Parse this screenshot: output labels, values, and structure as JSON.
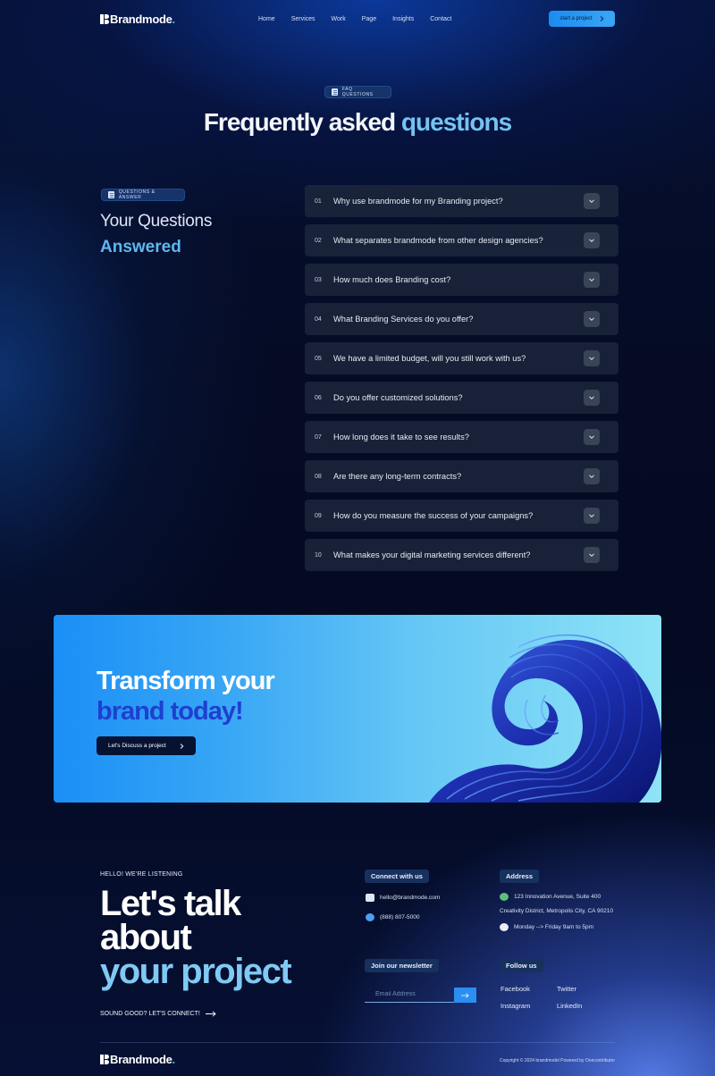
{
  "header": {
    "logo": "Brandmode",
    "nav": [
      "Home",
      "Services",
      "Work",
      "Page",
      "Insights",
      "Contact"
    ],
    "cta": "start a project"
  },
  "faq": {
    "badge": "FAQ QUESTIONS",
    "title_main": "Frequently asked ",
    "title_highlight": "questions",
    "side_badge": "QUESTIONS & ANSWER",
    "side_line1": "Your Questions",
    "side_line2": "Answered",
    "items": [
      {
        "num": "01",
        "question": "Why use brandmode for my Branding project?"
      },
      {
        "num": "02",
        "question": "What separates brandmode from other design agencies?"
      },
      {
        "num": "03",
        "question": "How much does Branding cost?"
      },
      {
        "num": "04",
        "question": "What Branding Services do you offer?"
      },
      {
        "num": "05",
        "question": "We have a limited budget, will you still work with us?"
      },
      {
        "num": "06",
        "question": "Do you offer customized solutions?"
      },
      {
        "num": "07",
        "question": "How long does it take to see results?"
      },
      {
        "num": "08",
        "question": "Are there any long-term contracts?"
      },
      {
        "num": "09",
        "question": "How do you measure the success of your campaigns?"
      },
      {
        "num": "10",
        "question": "What makes your digital marketing services different?"
      }
    ]
  },
  "banner": {
    "line1": "Transform your",
    "line2": "brand today!",
    "button": "Let's Discuss a project"
  },
  "footer": {
    "hello": "HELLO! WE'RE LISTENING",
    "talk_line1": "Let's talk",
    "talk_line2": "about",
    "talk_line3": "your project",
    "sound": "SOUND GOOD? LET'S CONNECT!",
    "connect_title": "Connect with us",
    "email": "hello@brandmode.com",
    "phone": "(888) 807-5000",
    "address_title": "Address",
    "address_line1": "123 Innovation Avenue, Suite 400",
    "address_line2": "Creativity District, Metropolis City, CA 90210",
    "hours": "Monday --> Friday 9am to 5pm",
    "newsletter_title": "Join our newsletter",
    "email_placeholder": "Email Address",
    "follow_title": "Follow us",
    "socials": [
      "Facebook",
      "Twitter",
      "Instagram",
      "LinkedIn"
    ],
    "logo": "Brandmode",
    "copyright": "Copyright © 2024 brandmodel Powered by Onecontributor"
  },
  "colors": {
    "accent": "#74c3f2",
    "cta": "#1b8cf0",
    "banner_dark_text": "#1f3fcf"
  }
}
